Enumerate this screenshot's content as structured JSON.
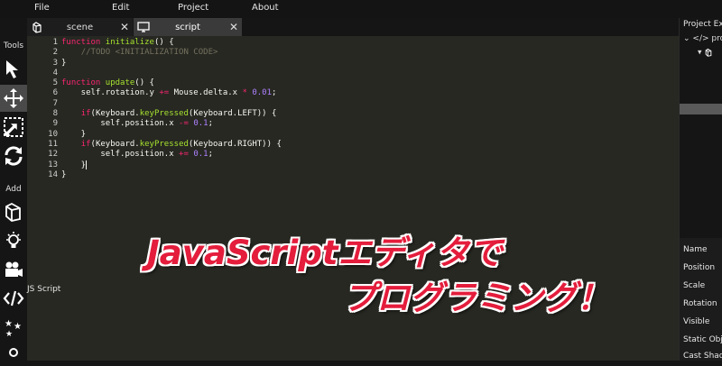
{
  "menu": [
    "File",
    "Edit",
    "Project",
    "About"
  ],
  "toolbar": {
    "tools_label": "Tools",
    "add_label": "Add",
    "tooltip": "JS Script"
  },
  "tabs": [
    {
      "label": "scene",
      "close": "✕"
    },
    {
      "label": "script",
      "close": "✕"
    }
  ],
  "editor": {
    "line_numbers": [
      "1",
      "2",
      "3",
      "4",
      "5",
      "6",
      "7",
      "8",
      "9",
      "10",
      "11",
      "12",
      "13",
      "14"
    ],
    "lines": [
      [
        {
          "t": "function",
          "c": "kw"
        },
        {
          "t": " "
        },
        {
          "t": "initialize",
          "c": "fn"
        },
        {
          "t": "() {"
        }
      ],
      [
        {
          "t": "    "
        },
        {
          "t": "//TODO <INITIALIZATION CODE>",
          "c": "cm"
        }
      ],
      [
        {
          "t": "}"
        }
      ],
      [],
      [
        {
          "t": "function",
          "c": "kw"
        },
        {
          "t": " "
        },
        {
          "t": "update",
          "c": "fn"
        },
        {
          "t": "() {"
        }
      ],
      [
        {
          "t": "    self.rotation.y "
        },
        {
          "t": "+=",
          "c": "kw"
        },
        {
          "t": " Mouse.delta.x "
        },
        {
          "t": "*",
          "c": "kw"
        },
        {
          "t": " "
        },
        {
          "t": "0.01",
          "c": "nm"
        },
        {
          "t": ";"
        }
      ],
      [],
      [
        {
          "t": "    "
        },
        {
          "t": "if",
          "c": "kw"
        },
        {
          "t": "(Keyboard."
        },
        {
          "t": "keyPressed",
          "c": "fn"
        },
        {
          "t": "(Keyboard.LEFT)) {"
        }
      ],
      [
        {
          "t": "        self.position.x "
        },
        {
          "t": "-=",
          "c": "kw"
        },
        {
          "t": " "
        },
        {
          "t": "0.1",
          "c": "nm"
        },
        {
          "t": ";"
        }
      ],
      [
        {
          "t": "    }"
        }
      ],
      [
        {
          "t": "    "
        },
        {
          "t": "if",
          "c": "kw"
        },
        {
          "t": "(Keyboard."
        },
        {
          "t": "keyPressed",
          "c": "fn"
        },
        {
          "t": "(Keyboard.RIGHT)) {"
        }
      ],
      [
        {
          "t": "        self.position.x "
        },
        {
          "t": "+=",
          "c": "kw"
        },
        {
          "t": " "
        },
        {
          "t": "0.1",
          "c": "nm"
        },
        {
          "t": ";"
        }
      ],
      [
        {
          "t": "    }"
        },
        {
          "cursor": true
        }
      ],
      [
        {
          "t": "}"
        }
      ]
    ]
  },
  "caption": {
    "line1": "JavaScriptエディタで",
    "line2": "プログラミング！"
  },
  "right_panel": {
    "title": "Project Ex",
    "tree": [
      "</> pro",
      "▾"
    ],
    "properties": [
      "Name",
      "Position",
      "Scale",
      "Rotation",
      "Visible",
      "Static Obje",
      "Cast Shad"
    ]
  },
  "colors": {
    "editor_bg": "#272822",
    "keyword": "#f92672",
    "function": "#a6e22e",
    "comment": "#75715e",
    "number": "#ae81ff",
    "caption": "#e41d3c"
  }
}
